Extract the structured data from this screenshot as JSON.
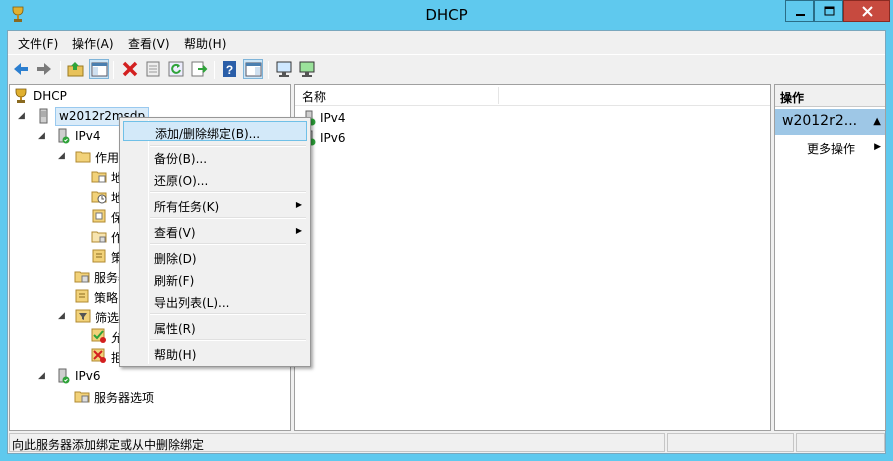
{
  "window": {
    "title": "DHCP"
  },
  "menubar": [
    {
      "label": "文件(F)"
    },
    {
      "label": "操作(A)"
    },
    {
      "label": "查看(V)"
    },
    {
      "label": "帮助(H)"
    }
  ],
  "toolbar": {
    "icons": [
      "back-arrow-icon",
      "forward-arrow-icon",
      "up-folder-icon",
      "show-hide-tree-icon",
      "delete-icon",
      "properties-icon",
      "refresh-icon",
      "export-list-icon",
      "help-icon",
      "show-hide-action-pane-icon",
      "monitor-icon",
      "monitor-green-icon"
    ]
  },
  "tree": {
    "root": "DHCP",
    "server": "w2012r2msdp",
    "ipv4": "IPv4",
    "scope": "作用域",
    "scope_child1": "地",
    "scope_child2": "地",
    "scope_child3": "保",
    "scope_child4": "作",
    "scope_child5": "策",
    "server_options": "服务器",
    "policies": "策略",
    "filters": "筛选器",
    "filter_allow": "允",
    "filter_deny": "拒",
    "ipv6": "IPv6",
    "ipv6_server_options": "服务器选项"
  },
  "list": {
    "column_name": "名称",
    "rows": [
      "IPv4",
      "IPv6"
    ]
  },
  "actions": {
    "title": "操作",
    "group": "w2012r2...",
    "more": "更多操作"
  },
  "context_menu": {
    "items": [
      {
        "label": "添加/删除绑定(B)..."
      },
      {
        "label": "备份(B)..."
      },
      {
        "label": "还原(O)..."
      },
      {
        "label": "所有任务(K)"
      },
      {
        "label": "查看(V)"
      },
      {
        "label": "删除(D)"
      },
      {
        "label": "刷新(F)"
      },
      {
        "label": "导出列表(L)..."
      },
      {
        "label": "属性(R)"
      },
      {
        "label": "帮助(H)"
      }
    ]
  },
  "statusbar": {
    "text": "向此服务器添加绑定或从中删除绑定"
  },
  "colors": {
    "titlebar": "#5fc9ee",
    "close": "#c74a3f",
    "selection": "#d3e9f9"
  }
}
